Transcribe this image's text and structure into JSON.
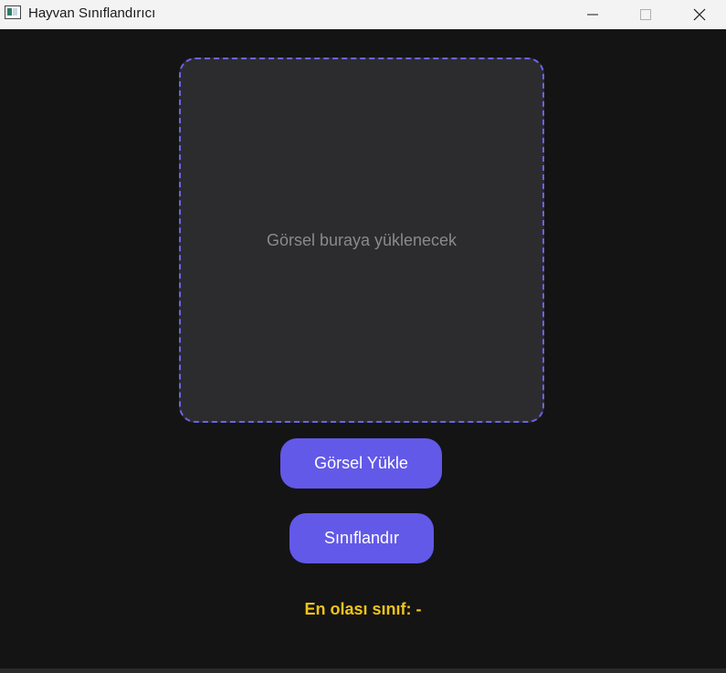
{
  "window": {
    "title": "Hayvan Sınıflandırıcı"
  },
  "image_area": {
    "placeholder": "Görsel buraya yüklenecek"
  },
  "buttons": {
    "load_label": "Görsel Yükle",
    "classify_label": "Sınıflandır"
  },
  "result": {
    "text": "En olası sınıf: -"
  },
  "colors": {
    "accent": "#6259e8",
    "result_text": "#f0c419",
    "background": "#141414",
    "panel": "#2c2c2f"
  }
}
